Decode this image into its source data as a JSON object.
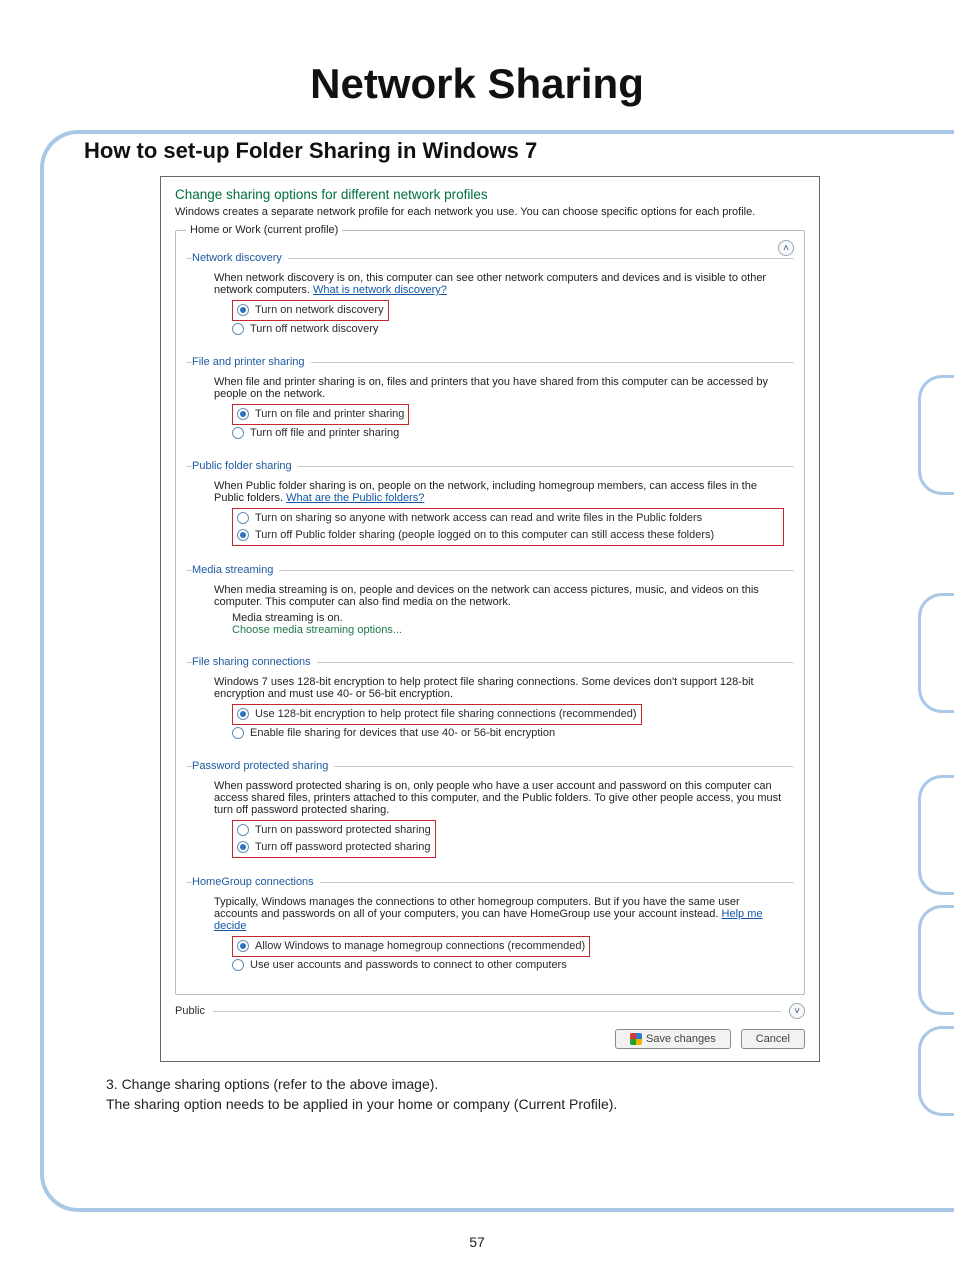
{
  "page": {
    "title": "Network Sharing",
    "heading": "How to set-up Folder Sharing in Windows 7",
    "number": "57",
    "step_line": "3. Change sharing options (refer to the above image).",
    "step_sub": "The sharing option needs to be applied in your home or company (Current Profile)."
  },
  "dialog": {
    "title": "Change sharing options for different network profiles",
    "subtitle": "Windows creates a separate network profile for each network you use. You can choose specific options for each profile.",
    "profile_label": "Home or Work (current profile)",
    "public_label": "Public",
    "save_btn": "Save changes",
    "cancel_btn": "Cancel",
    "groups": {
      "net_discovery": {
        "legend": "Network discovery",
        "desc": "When network discovery is on, this computer can see other network computers and devices and is visible to other network computers.",
        "link": "What is network discovery?",
        "opt_on": "Turn on network discovery",
        "opt_off": "Turn off network discovery"
      },
      "file_printer": {
        "legend": "File and printer sharing",
        "desc": "When file and printer sharing is on, files and printers that you have shared from this computer can be accessed by people on the network.",
        "opt_on": "Turn on file and printer sharing",
        "opt_off": "Turn off file and printer sharing"
      },
      "public_folder": {
        "legend": "Public folder sharing",
        "desc": "When Public folder sharing is on, people on the network, including homegroup members, can access files in the Public folders.",
        "link": "What are the Public folders?",
        "opt_on": "Turn on sharing so anyone with network access can read and write files in the Public folders",
        "opt_off": "Turn off Public folder sharing (people logged on to this computer can still access these folders)"
      },
      "media": {
        "legend": "Media streaming",
        "desc": "When media streaming is on, people and devices on the network can access pictures, music, and videos on this computer. This computer can also find media on the network.",
        "status": "Media streaming is on.",
        "link": "Choose media streaming options..."
      },
      "file_conn": {
        "legend": "File sharing connections",
        "desc": "Windows 7 uses 128-bit encryption to help protect file sharing connections. Some devices don't support 128-bit encryption and must use 40- or 56-bit encryption.",
        "opt_on": "Use 128-bit encryption to help protect file sharing connections (recommended)",
        "opt_off": "Enable file sharing for devices that use 40- or 56-bit encryption"
      },
      "password": {
        "legend": "Password protected sharing",
        "desc": "When password protected sharing is on, only people who have a user account and password on this computer can access shared files, printers attached to this computer, and the Public folders. To give other people access, you must turn off password protected sharing.",
        "opt_on": "Turn on password protected sharing",
        "opt_off": "Turn off password protected sharing"
      },
      "homegroup": {
        "legend": "HomeGroup connections",
        "desc": "Typically, Windows manages the connections to other homegroup computers. But if you have the same user accounts and passwords on all of your computers, you can have HomeGroup use your account instead.",
        "link": "Help me decide",
        "opt_on": "Allow Windows to manage homegroup connections (recommended)",
        "opt_off": "Use user accounts and passwords to connect to other computers"
      }
    }
  }
}
